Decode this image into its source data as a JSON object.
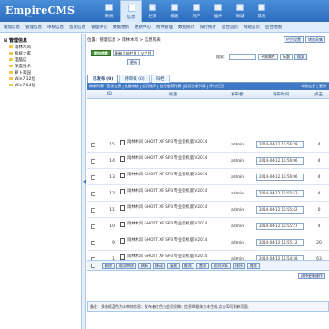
{
  "logo": {
    "text": "EmpireCMS",
    "sub": "-—"
  },
  "topnav": [
    {
      "label": "系统",
      "active": false
    },
    {
      "label": "信息",
      "active": true
    },
    {
      "label": "栏目",
      "active": false
    },
    {
      "label": "模板",
      "active": false
    },
    {
      "label": "用户",
      "active": false
    },
    {
      "label": "插件",
      "active": false
    },
    {
      "label": "商城",
      "active": false
    },
    {
      "label": "其他",
      "active": false
    }
  ],
  "subnav": [
    "增加信息",
    "管理信息",
    "审核信息",
    "签发信息",
    "管理评论",
    "数据更新",
    "更新中心",
    "附件管理",
    "数据统计",
    "排行统计",
    "后台首页",
    "网站首页",
    "后台地图"
  ],
  "sidebar": {
    "root": "管理信息",
    "items": [
      "雨林木风",
      "系统之家",
      "电脑店",
      "深度技术",
      "萝卜家园",
      "Win7 32位",
      "Win7 64位"
    ]
  },
  "breadcrumb": "位置：管理信息 > 雨林木风 > 信息列表",
  "crumb_buttons": [
    "栏目设置",
    "增加采集"
  ],
  "add_button": "增加信息",
  "column_select": "刷新当前栏目 | 父栏目",
  "refresh_button": "更新",
  "search": {
    "label": "搜索：",
    "select1": "不限属性",
    "select2": "标题",
    "button": "搜索"
  },
  "tabs": [
    "已发布 (9)",
    "待审核 (0)",
    "归档"
  ],
  "toolbar": [
    "刷新列表",
    "签发信息",
    "批量审核",
    "首页推荐",
    "首页推荐列表",
    "首页头条列表",
    "评价栏目",
    "评价信息",
    "操作说明"
  ],
  "toolbar_right": "审核信息 | 更新",
  "columns": {
    "id": "ID",
    "title": "标题",
    "publisher": "发布者",
    "time": "发布时间",
    "clicks": "点击"
  },
  "rows": [
    {
      "id": "15",
      "title": "雨林木风 GHOST XP SP3 专业装机版 V2014",
      "publisher": "admin",
      "date": "2014-04-12 15:56:29",
      "clicks": "4"
    },
    {
      "id": "14",
      "title": "雨林木风 GHOST XP SP3 专业装机版 V2014",
      "publisher": "admin",
      "date": "2014-04-12 15:56:06",
      "clicks": "4"
    },
    {
      "id": "13",
      "title": "雨林木风 GHOST XP SP3 专业装机版 V2014",
      "publisher": "admin",
      "date": "2014-04-12 15:56:06",
      "clicks": "4"
    },
    {
      "id": "12",
      "title": "雨林木风 GHOST XP SP3 专业装机版 V2014",
      "publisher": "admin",
      "date": "2014-04-12 15:55:53",
      "clicks": "4"
    },
    {
      "id": "11",
      "title": "雨林木风 GHOST XP SP3 专业装机版 V2014",
      "publisher": "admin",
      "date": "2014-04-12 15:55:42",
      "clicks": "0"
    },
    {
      "id": "10",
      "title": "雨林木风 GHOST XP SP3 专业装机版 V2014",
      "publisher": "admin",
      "date": "2014-04-12 15:55:27",
      "clicks": "4"
    },
    {
      "id": "9",
      "title": "雨林木风 GHOST XP SP3 专业装机版 V2014",
      "publisher": "admin",
      "date": "2014-04-12 15:55:12",
      "clicks": "20"
    },
    {
      "id": "1",
      "title": "雨林木风 GHOST XP SP3 专业装机版 V2014",
      "publisher": "admin",
      "date": "2014-04-12 15:54:58",
      "clicks": "63"
    }
  ],
  "bottom_buttons": [
    "删除",
    "取消审核",
    "刷新",
    "移动",
    "复制",
    "推荐",
    "置顶",
    "取消头条",
    "排序",
    "推荐"
  ],
  "page_button": "选择更新操作",
  "note": "备注：多选框蓝色为未审核信息；发布者红色为会员投稿；信息ID粗体为未生成,点击ID可刷新页面."
}
